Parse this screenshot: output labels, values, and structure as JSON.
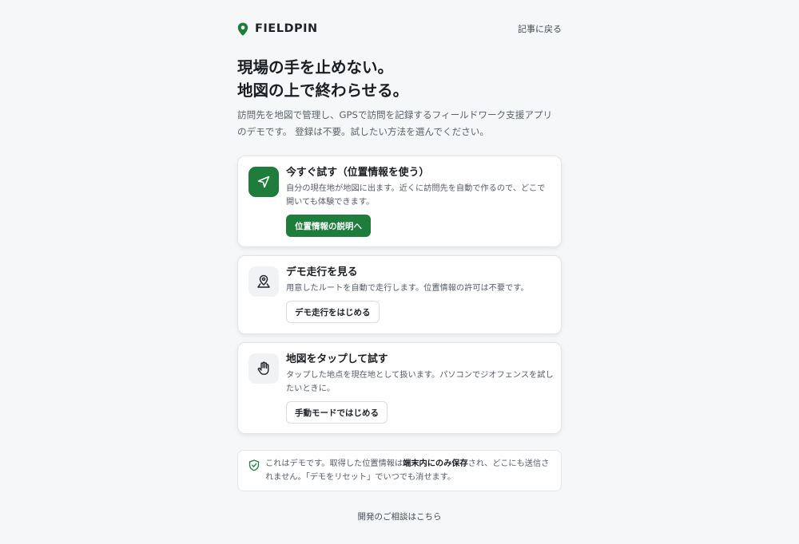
{
  "header": {
    "brand_name": "FIELDPIN",
    "logo_icon": "map-pin-icon",
    "back_link": "記事に戻る",
    "accent_color": "#1e7d3a"
  },
  "hero": {
    "title_line1": "現場の手を止めない。",
    "title_line2": "地図の上で終わらせる。",
    "intro_line1": "訪問先を地図で管理し、GPSで訪問を記録するフィールドワーク支援アプリ",
    "intro_line2": "のデモです。 登録は不要。試したい方法を選んでください。"
  },
  "cards": [
    {
      "icon": "navigation-arrow-icon",
      "title": "今すぐ試す（位置情報を使う）",
      "desc_line1": "自分の現在地が地図に出ます。近くに訪問先を自動で作るので、どこで",
      "desc_line2": "開いても体験できます。",
      "button_label": "位置情報の説明へ"
    },
    {
      "icon": "map-person-pin-icon",
      "title": "デモ走行を見る",
      "desc_line1": "用意したルートを自動で走行します。位置情報の許可は不要です。",
      "button_label": "デモ走行をはじめる"
    },
    {
      "icon": "hand-tap-icon",
      "title": "地図をタップして試す",
      "desc_line1": "タップした地点を現在地として扱います。パソコンでジオフェンスを試し",
      "desc_line2": "たいときに。",
      "button_label": "手動モードではじめる"
    }
  ],
  "notice": {
    "icon": "shield-check-icon",
    "text_before": "これはデモです。取得した位置情報は",
    "text_strong": "端末内にのみ保存",
    "text_after": "され、どこにも送信さ",
    "text_line2": "れません。「デモをリセット」でいつでも消せます。"
  },
  "footer": {
    "link": "開発のご相談はこちら"
  }
}
